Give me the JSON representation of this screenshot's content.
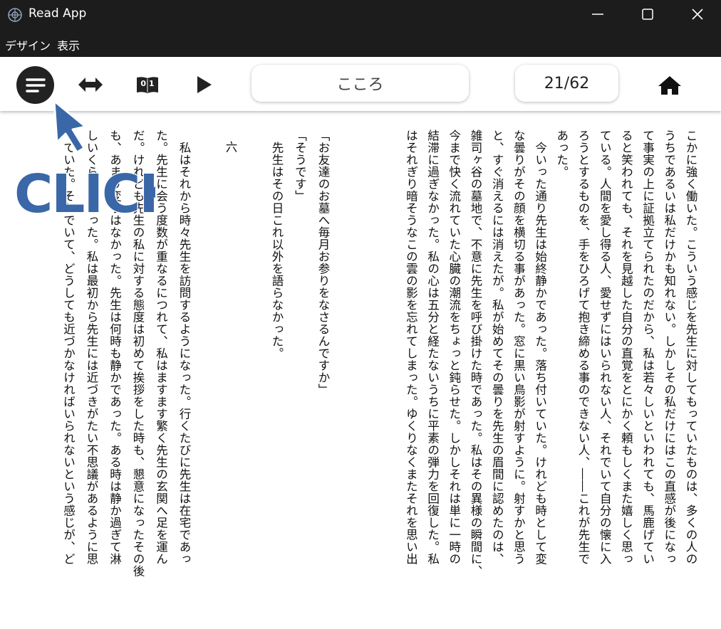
{
  "window": {
    "title": "Read App",
    "minimize_label": "minimize",
    "maximize_label": "maximize",
    "close_label": "close"
  },
  "menu": {
    "design": "デザイン",
    "view": "表示"
  },
  "toolbar": {
    "book_title": "こころ",
    "page_indicator": "21/62",
    "page_icon_text": "0 1"
  },
  "annotation": {
    "text": "CLICK",
    "color": "#3a67a8"
  },
  "page_right": [
    "こかに強く働いた。こういう感じを先生に対してもっていたものは、多くの人の",
    "うちであるいは私だけかも知れない。しかしその私だけにはこの直感が後になっ",
    "て事実の上に証拠立てられたのだから、私は若々しいといわれても、馬鹿げてい",
    "ると笑われても、それを見越した自分の直覚をとにかく頼もしくまた嬉しく思っ",
    "ている。人間を愛し得る人、愛せずにはいられない人、それでいて自分の懐に入",
    "ろうとするものを、手をひろげて抱き締める事のできない人、――これが先生で",
    "あった。",
    "　今いった通り先生は始終静かであった。落ち付いていた。けれども時として変",
    "な曇りがその顔を横切る事があった。窓に黒い鳥影が射すように。射すかと思う",
    "と、すぐ消えるには消えたが。私が始めてその曇りを先生の眉間に認めたのは、",
    "雑司ヶ谷の墓地で、不意に先生を呼び掛けた時であった。私はその異様の瞬間に、",
    "今まで快く流れていた心臓の潮流をちょっと鈍らせた。しかしそれは単に一時の",
    "結滞に過ぎなかった。私の心は五分と経たないうちに平素の弾力を回復した。私",
    "はそれぎり暗そうなこの雲の影を忘れてしまった。ゆくりなくまたそれを思い出"
  ],
  "page_left": [
    "「お友達のお墓へ毎月お参りをなさるんですか」",
    "「そうです」",
    "　先生はその日これ以外を語らなかった。",
    "",
    "六",
    "",
    "　私はそれから時々先生を訪問するようになった。行くたびに先生は在宅であっ",
    "た。先生に会う度数が重なるにつれて、私はますます繁く先生の玄関へ足を運ん",
    "だ。けれども先生の私に対する態度は初めて挨拶をした時も、懇意になったその後",
    "も、あまり変りはなかった。先生は何時も静かであった。ある時は静か過ぎて淋",
    "しいくらいであった。私は最初から先生には近づきがたい不思議があるように思",
    "っていた。それでいて、どうしても近づかなければいられないという感じが、ど"
  ]
}
